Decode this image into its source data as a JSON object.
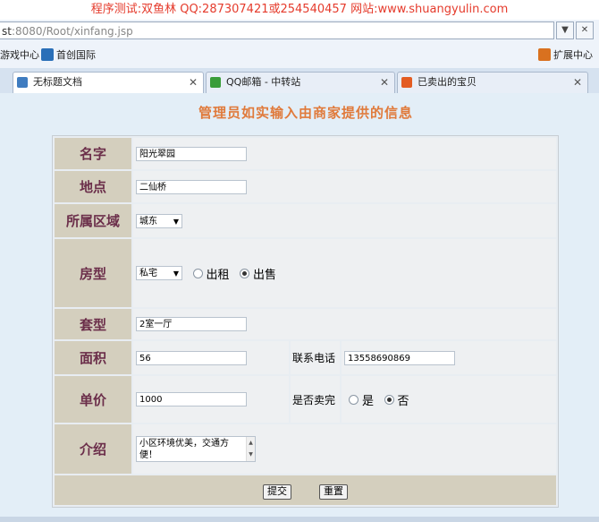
{
  "banner": "程序测试:双鱼林 QQ:287307421或254540457 网站:www.shuangyulin.com",
  "address": {
    "host": "st",
    "rest": ":8080/Root/xinfang.jsp"
  },
  "favorites": [
    {
      "label": "游戏中心",
      "icon": "game-icon",
      "color": "#2f8f3a"
    },
    {
      "label": "首创国际",
      "icon": "bookmark-icon",
      "color": "#2a6fb8"
    },
    {
      "label": "扩展中心",
      "icon": "cube-icon",
      "color": "#d9711f"
    }
  ],
  "tabs": [
    {
      "label": "无标题文档",
      "color": "#3f7cc0"
    },
    {
      "label": "QQ邮箱 - 中转站",
      "color": "#3a9d3a"
    },
    {
      "label": "已卖出的宝贝",
      "color": "#e35c22"
    }
  ],
  "heading": "管理员如实输入由商家提供的信息",
  "form": {
    "name_label": "名字",
    "name_value": "阳光翠园",
    "location_label": "地点",
    "location_value": "二仙桥",
    "district_label": "所属区域",
    "district_value": "城东",
    "type_label": "房型",
    "type_value": "私宅",
    "rent_label": "出租",
    "sale_label": "出售",
    "layout_label": "套型",
    "layout_value": "2室一厅",
    "area_label": "面积",
    "area_value": "56",
    "phone_label": "联系电话",
    "phone_value": "13558690869",
    "price_label": "单价",
    "price_value": "1000",
    "sold_label": "是否卖完",
    "yes_label": "是",
    "no_label": "否",
    "intro_label": "介绍",
    "intro_value": "小区环境优美，交通方便！",
    "submit_label": "提交",
    "reset_label": "重置"
  }
}
